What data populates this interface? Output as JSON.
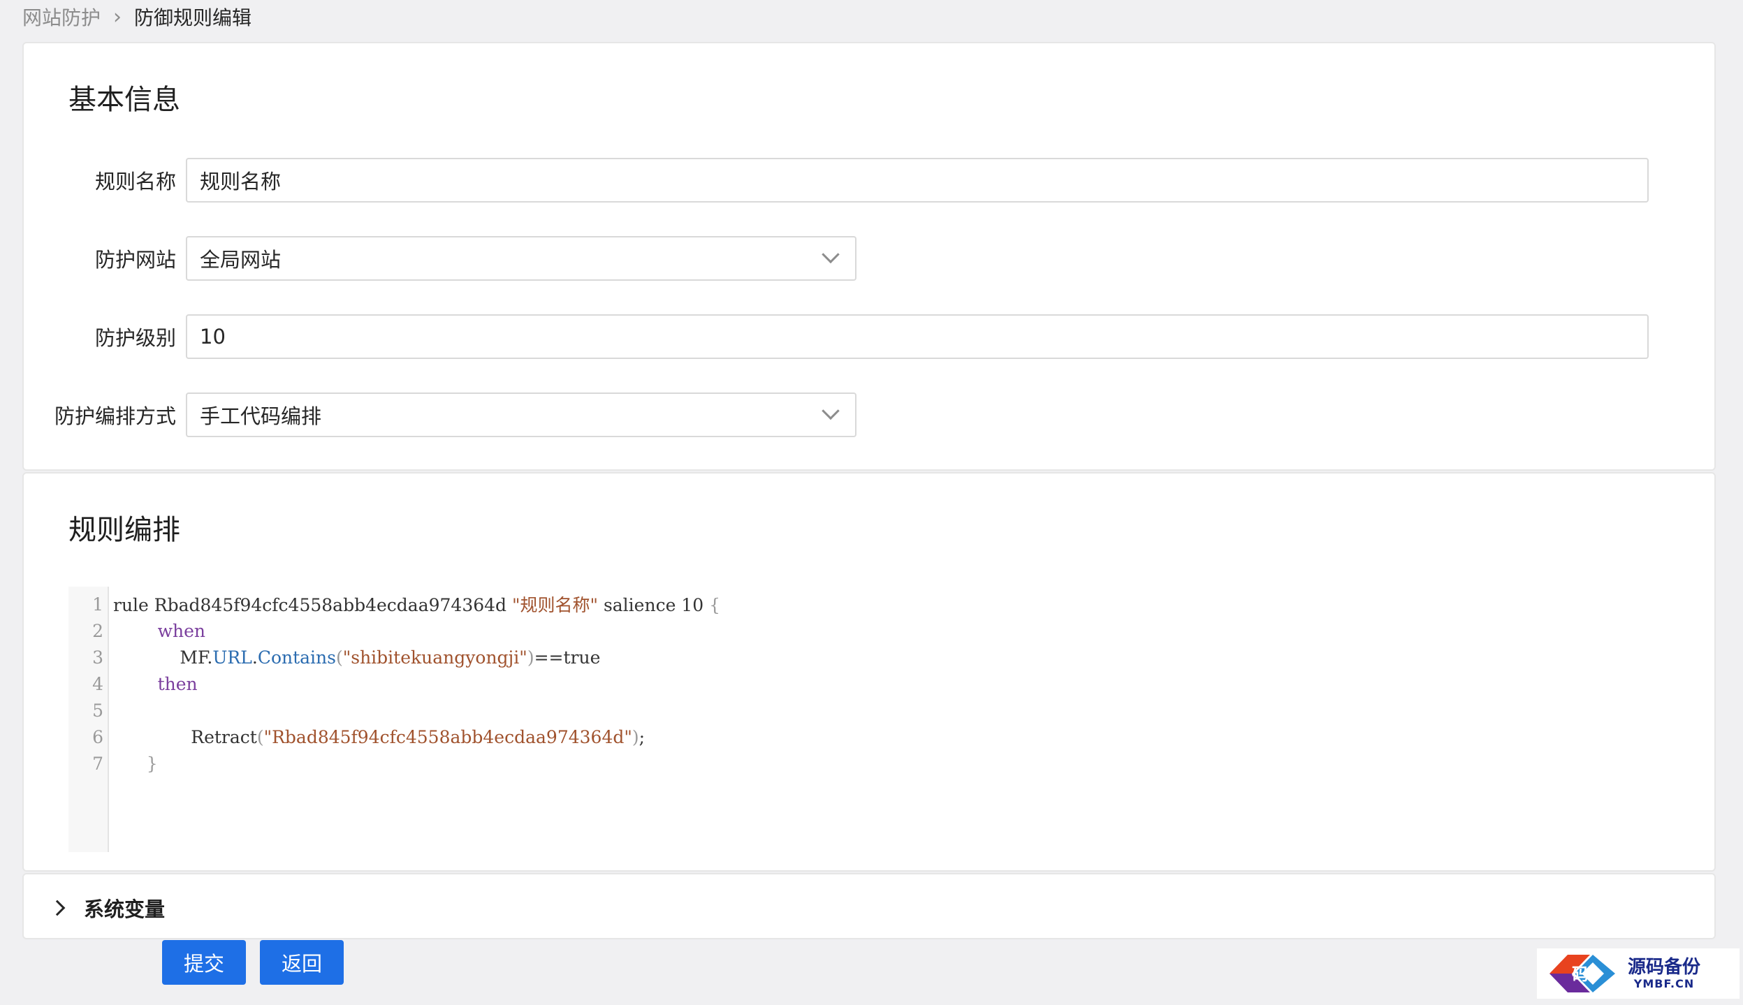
{
  "breadcrumb": {
    "parent": "网站防护",
    "separator": "›",
    "current": "防御规则编辑"
  },
  "basic_info": {
    "title": "基本信息",
    "fields": {
      "rule_name": {
        "label": "规则名称",
        "value": "规则名称"
      },
      "protected_site": {
        "label": "防护网站",
        "value": "全局网站"
      },
      "protection_level": {
        "label": "防护级别",
        "value": "10"
      },
      "arrangement_mode": {
        "label": "防护编排方式",
        "value": "手工代码编排"
      }
    }
  },
  "rule_editor": {
    "title": "规则编排",
    "lines": [
      {
        "n": "1",
        "t1": "rule Rbad845f94cfc4558abb4ecdaa974364d ",
        "t2": "\"规则名称\"",
        "t3": " salience 10 ",
        "t4": "{"
      },
      {
        "n": "2",
        "t1": "        ",
        "t2": "when"
      },
      {
        "n": "3",
        "t1": "            MF.",
        "t2": "URL",
        "t3": ".",
        "t4": "Contains",
        "t5": "(",
        "t6": "\"shibitekuangyongji\"",
        "t7": ")",
        "t8": "==true"
      },
      {
        "n": "4",
        "t1": "        ",
        "t2": "then"
      },
      {
        "n": "5"
      },
      {
        "n": "6",
        "t1": "              Retract",
        "t2": "(",
        "t3": "\"Rbad845f94cfc4558abb4ecdaa974364d\"",
        "t4": ")",
        "t5": ";"
      },
      {
        "n": "7",
        "t1": "      ",
        "t2": "}"
      }
    ]
  },
  "system_vars": {
    "label": "系统变量"
  },
  "buttons": {
    "submit": "提交",
    "back": "返回"
  },
  "watermark": {
    "title": "源码备份",
    "subtitle": "YMBF.CN",
    "logo_char": "码"
  },
  "colors": {
    "primary": "#1e6fe6",
    "keyword": "#7a3e9d",
    "string": "#a0522d",
    "property": "#2b6cb0"
  }
}
